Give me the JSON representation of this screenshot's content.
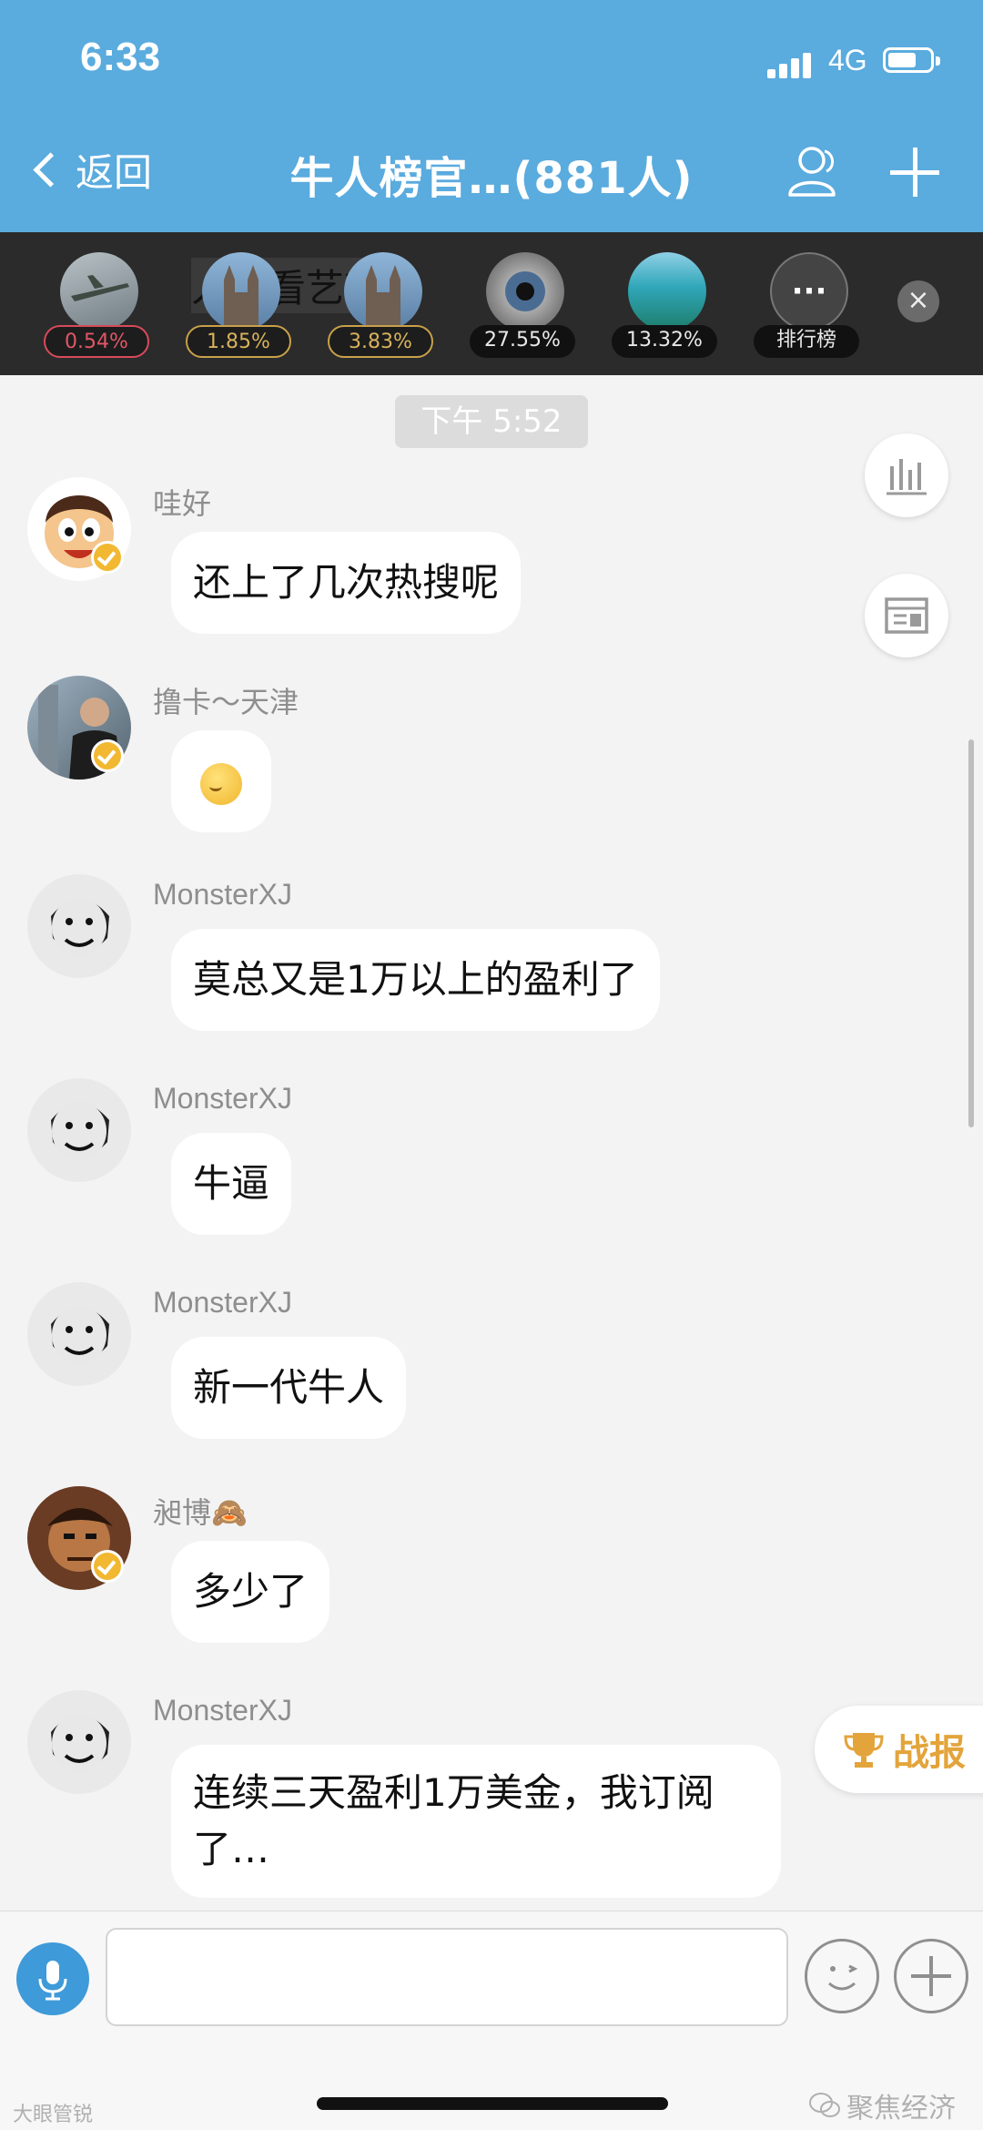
{
  "status_bar": {
    "time": "6:33",
    "network": "4G"
  },
  "nav": {
    "back_label": "返回",
    "title": "牛人榜官…(881人)"
  },
  "rank_bar": {
    "ticker": "人不看艺节",
    "items": [
      {
        "pct": "0.54%",
        "style": "red",
        "thumb": "plane"
      },
      {
        "pct": "1.85%",
        "style": "gold",
        "thumb": "church"
      },
      {
        "pct": "3.83%",
        "style": "gold",
        "thumb": "church"
      },
      {
        "pct": "27.55%",
        "style": "plain",
        "thumb": "eye"
      },
      {
        "pct": "13.32%",
        "style": "plain",
        "thumb": "sea"
      }
    ],
    "more_label": "排行榜"
  },
  "chat": {
    "timestamp": "下午 5:52",
    "messages": [
      {
        "name": "哇好",
        "text": "还上了几次热搜呢"
      },
      {
        "name": "撸卡～天津",
        "text": ""
      },
      {
        "name": "MonsterXJ",
        "text": "莫总又是1万以上的盈利了"
      },
      {
        "name": "MonsterXJ",
        "text": "牛逼"
      },
      {
        "name": "MonsterXJ",
        "text": "新一代牛人"
      },
      {
        "name": "昶博🙈",
        "text": "多少了"
      },
      {
        "name": "MonsterXJ",
        "text": "连续三天盈利1万美金，我订阅了…"
      }
    ]
  },
  "floating": {
    "zhanbao_label": "战报"
  },
  "input": {
    "placeholder": ""
  },
  "watermarks": {
    "left": "大眼管锐",
    "right": "聚焦经济"
  },
  "colors": {
    "header": "#5aabde",
    "badge": "#f2b832",
    "mic": "#3e9ad8",
    "zhanbao": "#e3a43b"
  }
}
